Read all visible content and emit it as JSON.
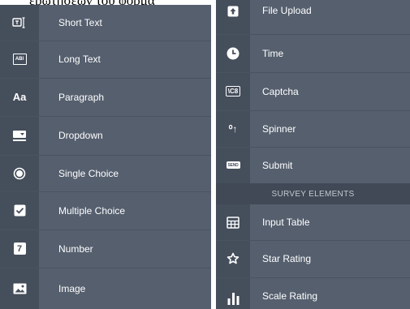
{
  "caption": "ερωτήσεων του φόρμα",
  "left_panel": {
    "items": [
      {
        "label": "Short Text",
        "icon": "short-text-icon"
      },
      {
        "label": "Long Text",
        "icon": "long-text-icon",
        "icon_text": "ABI"
      },
      {
        "label": "Paragraph",
        "icon": "paragraph-icon",
        "icon_text": "Aa"
      },
      {
        "label": "Dropdown",
        "icon": "dropdown-icon"
      },
      {
        "label": "Single Choice",
        "icon": "radio-icon"
      },
      {
        "label": "Multiple Choice",
        "icon": "checkbox-icon"
      },
      {
        "label": "Number",
        "icon": "number-icon",
        "icon_text": "7"
      },
      {
        "label": "Image",
        "icon": "image-icon"
      }
    ]
  },
  "right_panel": {
    "items_top": [
      {
        "label": "File Upload",
        "icon": "file-upload-icon"
      },
      {
        "label": "Time",
        "icon": "clock-icon"
      },
      {
        "label": "Captcha",
        "icon": "captcha-icon",
        "icon_text": "\\C8"
      },
      {
        "label": "Spinner",
        "icon": "spinner-icon",
        "icon_text": "⁰↑"
      },
      {
        "label": "Submit",
        "icon": "submit-icon",
        "icon_text": "SEND"
      }
    ],
    "section_header": "SURVEY ELEMENTS",
    "items_bottom": [
      {
        "label": "Input Table",
        "icon": "table-icon"
      },
      {
        "label": "Star Rating",
        "icon": "star-icon"
      },
      {
        "label": "Scale Rating",
        "icon": "bar-chart-icon"
      }
    ]
  },
  "colors": {
    "panel": "#555f6e",
    "rail": "#454e5b",
    "section": "#404955",
    "text": "#ffffff"
  }
}
